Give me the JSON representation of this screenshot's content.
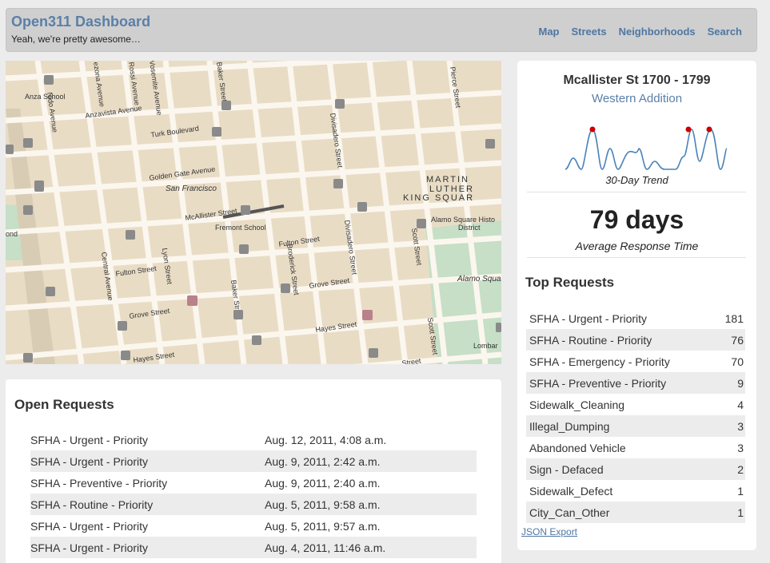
{
  "header": {
    "brand": "Open311 Dashboard",
    "tagline": "Yeah, we're pretty awesome…",
    "nav": [
      "Map",
      "Streets",
      "Neighborhoods",
      "Search"
    ]
  },
  "map": {
    "labels": {
      "anza_school": "Anza School",
      "anzavista_ave": "Anzavista Avenue",
      "turk_blvd": "Turk Boulevard",
      "golden_gate_ave": "Golden Gate Avenue",
      "san_francisco": "San Francisco",
      "mcallister_st": "McAllister Street",
      "fremont_school": "Fremont School",
      "fulton_st_left": "Fulton Street",
      "fulton_st_right": "Fulton Street",
      "grove_st_left": "Grove Street",
      "grove_st_right": "Grove Street",
      "hayes_st_left": "Hayes Street",
      "hayes_st_right": "Hayes Street",
      "central_ave": "Central Avenue",
      "lyon_st": "Lyon Street",
      "baker_st_top": "Baker Street",
      "baker_st_bottom": "Baker Street",
      "broderick_st": "Broderick Street",
      "divisadero_st_top": "Divisadero Street",
      "divisadero_st_bottom": "Divisadero Street",
      "scott_st_top": "Scott Street",
      "scott_st_bottom": "Scott Street",
      "pierce_st": "Pierce Street",
      "nido_ave": "Nido Avenue",
      "ezona_ave": "ezona Avenue",
      "rossi_ave": "Rossi Avenue",
      "vosemite_ave": "Vosemite Avenue",
      "mlk_1": "MARTIN",
      "mlk_2": "LUTHER",
      "mlk_3": "KING SQUAR",
      "alamo_hist_1": "Alamo Square Histo",
      "alamo_hist_2": "District",
      "alamo_square": "Alamo Square",
      "lombard": "Lombar",
      "bond": "ond",
      "street_cut": "Street"
    }
  },
  "open_requests": {
    "title": "Open Requests",
    "rows": [
      {
        "type": "SFHA - Urgent - Priority",
        "date": "Aug. 12, 2011, 4:08 a.m."
      },
      {
        "type": "SFHA - Urgent - Priority",
        "date": "Aug. 9, 2011, 2:42 a.m."
      },
      {
        "type": "SFHA - Preventive - Priority",
        "date": "Aug. 9, 2011, 2:40 a.m."
      },
      {
        "type": "SFHA - Routine - Priority",
        "date": "Aug. 5, 2011, 9:58 a.m."
      },
      {
        "type": "SFHA - Urgent - Priority",
        "date": "Aug. 5, 2011, 9:57 a.m."
      },
      {
        "type": "SFHA - Urgent - Priority",
        "date": "Aug. 4, 2011, 11:46 a.m."
      }
    ]
  },
  "side": {
    "location_title": "Mcallister St 1700 - 1799",
    "neighborhood": "Western Addition",
    "trend_label": "30-Day Trend",
    "avg_value": "79 days",
    "avg_label": "Average Response Time",
    "top_title": "Top Requests",
    "top_requests": [
      {
        "name": "SFHA - Urgent - Priority",
        "count": "181"
      },
      {
        "name": "SFHA - Routine - Priority",
        "count": "76"
      },
      {
        "name": "SFHA - Emergency - Priority",
        "count": "70"
      },
      {
        "name": "SFHA - Preventive - Priority",
        "count": "9"
      },
      {
        "name": "Sidewalk_Cleaning",
        "count": "4"
      },
      {
        "name": "Illegal_Dumping",
        "count": "3"
      },
      {
        "name": "Abandoned Vehicle",
        "count": "3"
      },
      {
        "name": "Sign - Defaced",
        "count": "2"
      },
      {
        "name": "Sidewalk_Defect",
        "count": "1"
      },
      {
        "name": "City_Can_Other",
        "count": "1"
      }
    ],
    "json_export": "JSON Export"
  },
  "colors": {
    "brand": "#5b7fa6",
    "link": "#4f76a3",
    "sparkline": "#4a82b8",
    "spark_peak": "#cc0000",
    "map_land": "#e9dcc5",
    "map_park": "#c6dfc6"
  }
}
